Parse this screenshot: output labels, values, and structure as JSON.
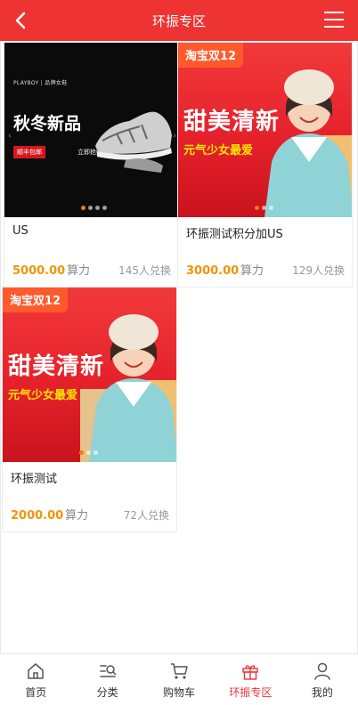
{
  "header": {
    "title": "环振专区"
  },
  "products": [
    {
      "name": "US",
      "price": "5000.00",
      "unit": "算力",
      "redeemed": "145人兑换",
      "banner": {
        "type": "shoes",
        "brand": "PLAYBOY | 品牌女鞋",
        "headline": "秋冬新品",
        "tag": "顺丰包邮",
        "cta": "立即抢购"
      }
    },
    {
      "name": "环振测试积分加US",
      "price": "3000.00",
      "unit": "算力",
      "redeemed": "129人兑换",
      "banner": {
        "type": "red",
        "badge": "淘宝双12",
        "big": "甜美清新",
        "small": "元气少女最爱"
      }
    },
    {
      "name": "环振测试",
      "price": "2000.00",
      "unit": "算力",
      "redeemed": "72人兑换",
      "banner": {
        "type": "red",
        "badge": "淘宝双12",
        "big": "甜美清新",
        "small": "元气少女最爱"
      }
    }
  ],
  "tabbar": [
    {
      "label": "首页",
      "icon": "home-icon"
    },
    {
      "label": "分类",
      "icon": "category-search-icon"
    },
    {
      "label": "购物车",
      "icon": "cart-icon"
    },
    {
      "label": "环振专区",
      "icon": "gift-icon",
      "active": true
    },
    {
      "label": "我的",
      "icon": "user-icon"
    }
  ],
  "colors": {
    "brand_red": "#ee3333",
    "price_orange": "#f29407"
  }
}
